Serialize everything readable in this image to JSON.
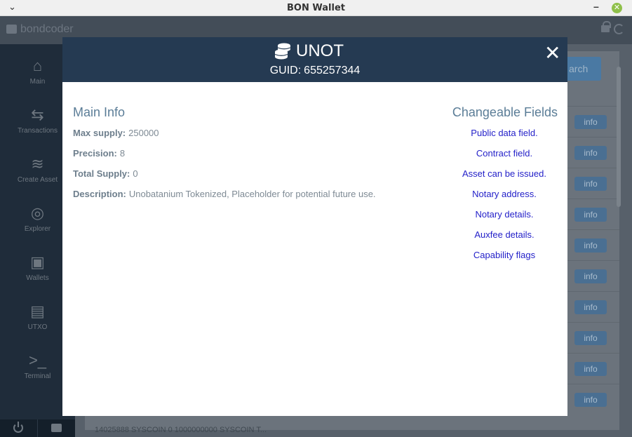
{
  "window": {
    "title": "BON Wallet"
  },
  "app": {
    "username": "bondcoder",
    "search_label": "arch",
    "info_label": "info",
    "rows": 10,
    "bottom_row": "14025888     SYSCOIN     0     1000000000        SYSCOIN T..."
  },
  "sidebar": {
    "items": [
      {
        "label": "Main",
        "icon": "home-icon"
      },
      {
        "label": "Transactions",
        "icon": "signpost-icon"
      },
      {
        "label": "Create Asset",
        "icon": "coins-icon"
      },
      {
        "label": "Explorer",
        "icon": "compass-icon"
      },
      {
        "label": "Wallets",
        "icon": "wallet-icon"
      },
      {
        "label": "UTXO",
        "icon": "money-bill-icon"
      },
      {
        "label": "Terminal",
        "icon": "terminal-icon"
      }
    ]
  },
  "modal": {
    "symbol": "UNOT",
    "guid_label": "GUID:",
    "guid": "655257344",
    "main_info": {
      "title": "Main Info",
      "max_supply_label": "Max supply:",
      "max_supply": "250000",
      "precision_label": "Precision:",
      "precision": "8",
      "total_supply_label": "Total Supply:",
      "total_supply": "0",
      "description_label": "Description:",
      "description": "Unobatanium Tokenized, Placeholder for potential future use."
    },
    "changeable": {
      "title": "Changeable Fields",
      "fields": [
        "Public data field.",
        "Contract field.",
        "Asset can be issued.",
        "Notary address.",
        "Notary details.",
        "Auxfee details.",
        "Capability flags"
      ]
    }
  }
}
